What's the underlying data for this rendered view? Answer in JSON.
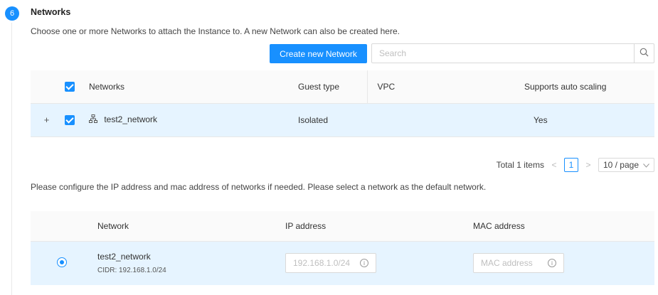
{
  "step": {
    "number": "6",
    "title": "Networks",
    "description": "Choose one or more Networks to attach the Instance to. A new Network can also be created here."
  },
  "toolbar": {
    "create_label": "Create new Network",
    "search_placeholder": "Search",
    "search_value": ""
  },
  "networks_table": {
    "columns": {
      "name": "Networks",
      "guest_type": "Guest type",
      "vpc": "VPC",
      "auto_scaling": "Supports auto scaling"
    },
    "rows": [
      {
        "name": "test2_network",
        "guest_type": "Isolated",
        "vpc": "",
        "auto_scaling": "Yes",
        "selected": true
      }
    ]
  },
  "pagination": {
    "total": "Total 1 items",
    "page": "1",
    "page_size": "10 / page"
  },
  "config": {
    "description": "Please configure the IP address and mac address of networks if needed. Please select a network as the default network.",
    "columns": {
      "network": "Network",
      "ip": "IP address",
      "mac": "MAC address"
    },
    "rows": [
      {
        "name": "test2_network",
        "cidr": "CIDR: 192.168.1.0/24",
        "ip_placeholder": "192.168.1.0/24",
        "mac_placeholder": "MAC address",
        "is_default": true
      }
    ]
  },
  "colors": {
    "accent": "#1890ff",
    "row_highlight": "#e6f4ff"
  },
  "icons": {
    "search": "search-icon",
    "network": "network-icon",
    "info": "info-icon",
    "expand": "plus-icon",
    "dropdown": "chevron-down-icon"
  }
}
